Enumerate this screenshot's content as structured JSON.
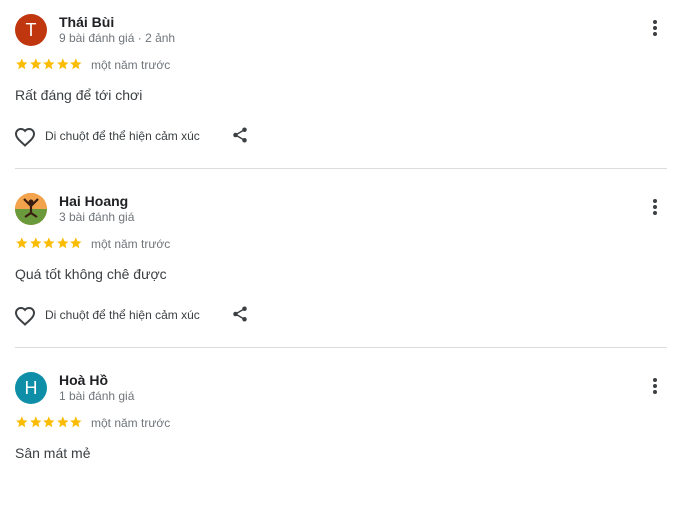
{
  "colors": {
    "star": "#fbbc04",
    "avatar_t": "#c0370f",
    "avatar_h": "#0e8fa7",
    "text": "#3c4043",
    "muted": "#70757a"
  },
  "reviews": [
    {
      "avatar_letter": "T",
      "name": "Thái Bùi",
      "meta": "9 bài đánh giá · 2 ảnh",
      "rating": 5,
      "date": "một năm trước",
      "text": "Rất đáng để tới chơi",
      "like_label": "Di chuột để thể hiện cảm xúc"
    },
    {
      "avatar_letter": "",
      "name": "Hai Hoang",
      "meta": "3 bài đánh giá",
      "rating": 5,
      "date": "một năm trước",
      "text": "Quá tốt không chê được",
      "like_label": "Di chuột để thể hiện cảm xúc"
    },
    {
      "avatar_letter": "H",
      "name": "Hoà Hồ",
      "meta": "1 bài đánh giá",
      "rating": 5,
      "date": "một năm trước",
      "text": "Sân mát mẻ"
    }
  ]
}
